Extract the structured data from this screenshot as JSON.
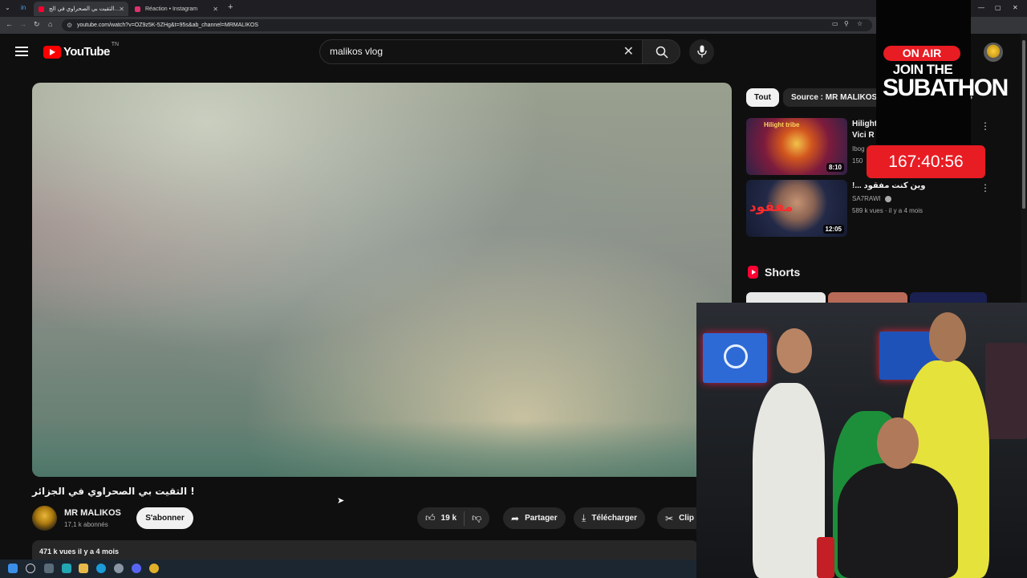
{
  "browser": {
    "tabs": [
      {
        "label": "التقيت بي الصحراوي في الج…",
        "color": "#ff0033"
      },
      {
        "label": "Réaction • Instagram",
        "color": "#e1306c"
      }
    ],
    "url": "youtube.com/watch?v=OZ9z5K-5ZHg&t=95s&ab_channel=MRMALIKOS"
  },
  "header": {
    "logo_text": "YouTube",
    "logo_region": "TN",
    "search_value": "malikos vlog"
  },
  "video": {
    "title": "! التقيت بي الصحراوي في الجزائر",
    "channel_name": "MR MALIKOS",
    "subscribers": "17,1 k abonnés",
    "subscribe_label": "S'abonner",
    "likes": "19 k",
    "share_label": "Partager",
    "download_label": "Télécharger",
    "clip_label": "Clip",
    "views_date": "471 k vues  il y a 4 mois"
  },
  "sidebar": {
    "chips": [
      "Tout",
      "Source : MR MALIKOS"
    ],
    "recommendations": [
      {
        "title_line1": "Hilight",
        "title_line2": "Vici R",
        "channel": "Ibog",
        "meta": "150",
        "duration": "8:10",
        "thumb_text": "Hilight tribe"
      },
      {
        "title_line1": "وين كنت مفقود ...!",
        "channel": "SA7RAWI",
        "meta": "589 k vues · il y a 4 mois",
        "duration": "12:05",
        "thumb_text": "مفقود"
      }
    ],
    "shorts_label": "Shorts"
  },
  "overlay": {
    "on_air": "ON AIR",
    "join_the": "JOIN THE",
    "subathon": "SUBATHON",
    "timer": "167:40:56"
  },
  "colors": {
    "brand_red": "#ff0000",
    "overlay_red": "#e81c23",
    "background": "#0f0f0f"
  }
}
